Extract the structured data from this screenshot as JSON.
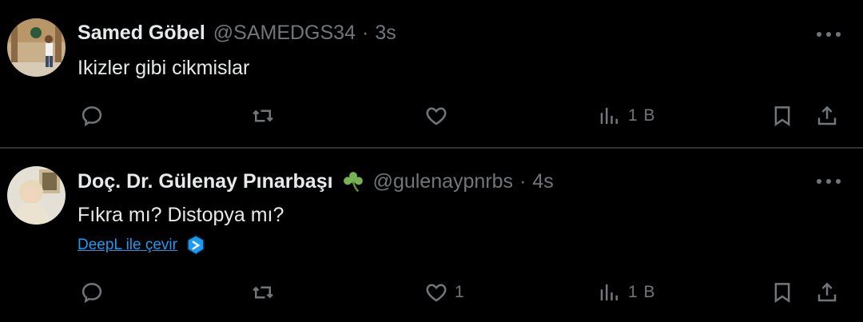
{
  "tweets": [
    {
      "author": "Samed Göbel",
      "handle": "@SAMEDGS34",
      "separator": "·",
      "time": "3s",
      "text": "Ikizler gibi cikmislar",
      "likes": "",
      "views": "1 B"
    },
    {
      "author": "Doç. Dr. Gülenay Pınarbaşı",
      "badge_icon": "shamrock-icon",
      "handle": "@gulenaypnrbs",
      "separator": "·",
      "time": "4s",
      "text": "Fıkra mı? Distopya mı?",
      "translate_label": "DeepL ile çevir",
      "likes": "1",
      "views": "1 B"
    }
  ],
  "colors": {
    "background": "#000000",
    "text": "#e7e9ea",
    "muted": "#71767b",
    "link": "#1d9bf0",
    "divider": "#2f3336"
  }
}
